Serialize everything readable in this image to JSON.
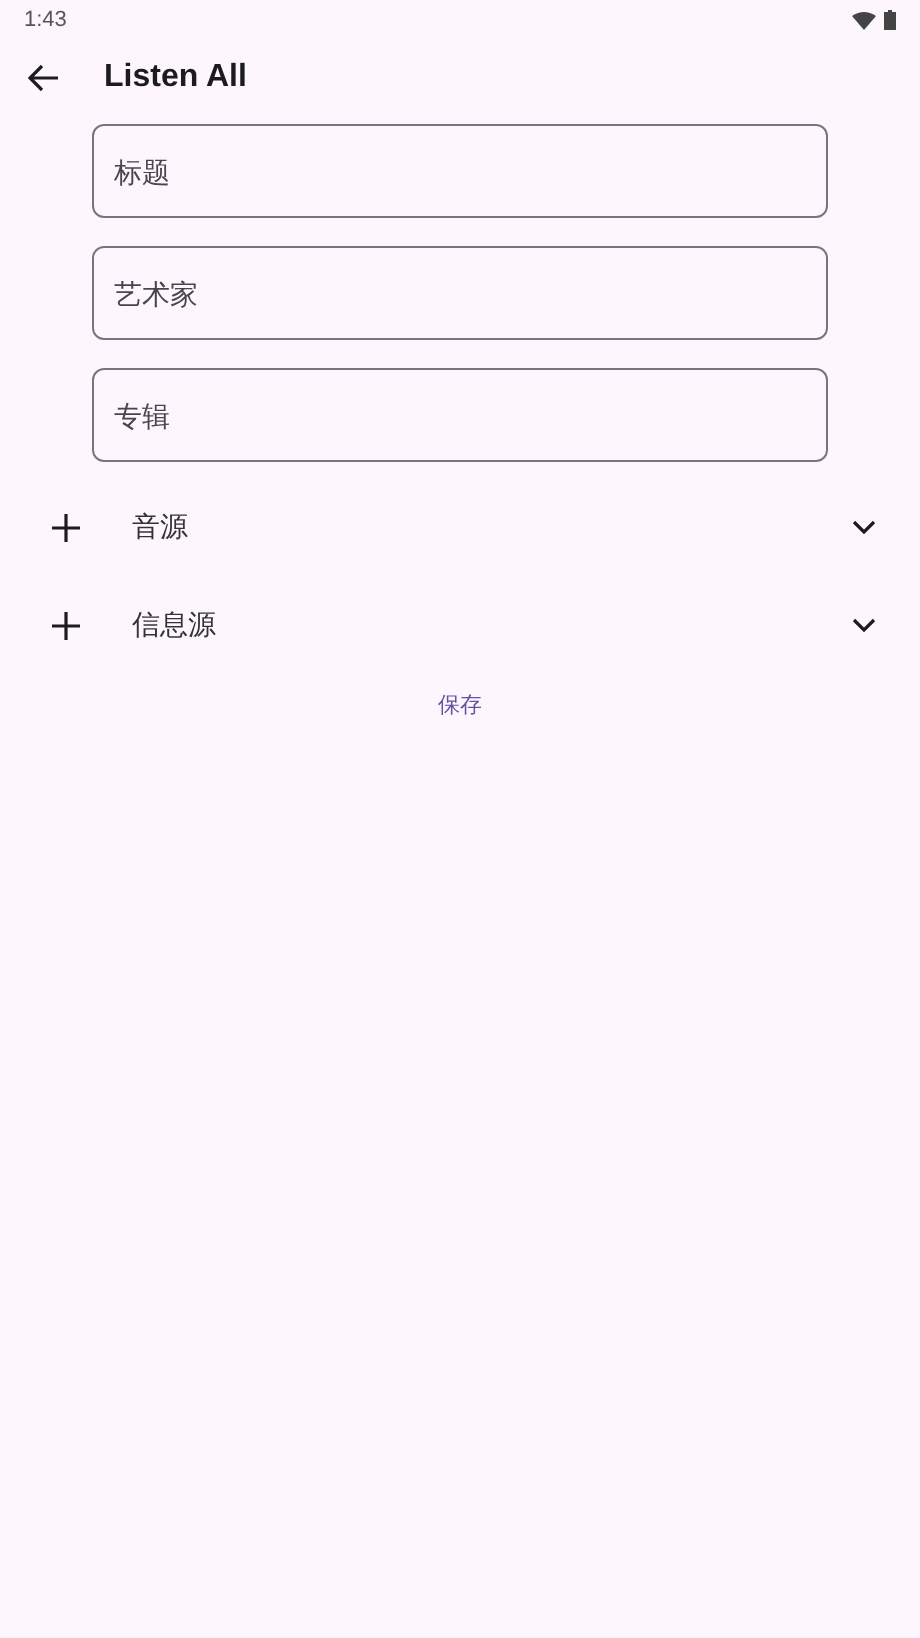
{
  "status_bar": {
    "time": "1:43"
  },
  "app_bar": {
    "title": "Listen All"
  },
  "fields": [
    {
      "placeholder": "标题"
    },
    {
      "placeholder": "艺术家"
    },
    {
      "placeholder": "专辑"
    }
  ],
  "sections": [
    {
      "label": "音源",
      "expanded": false
    },
    {
      "label": "信息源",
      "expanded": false
    }
  ],
  "save_button": "保存"
}
